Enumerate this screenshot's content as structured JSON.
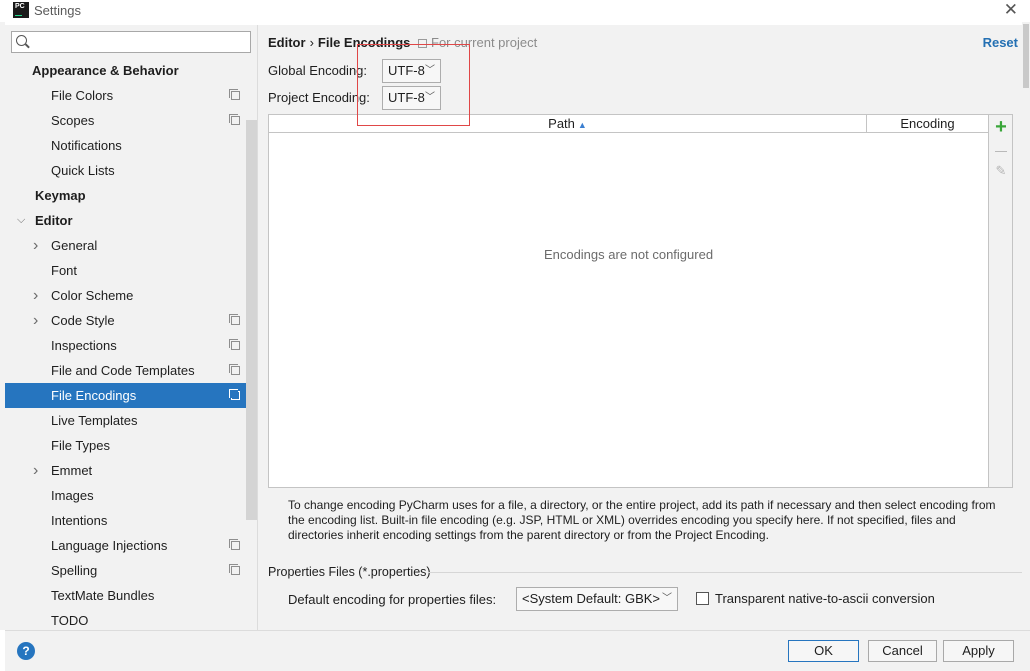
{
  "window": {
    "title": "Settings",
    "app_icon": "pycharm-logo",
    "app_icon_text": "PC"
  },
  "search": {
    "placeholder": "",
    "value": ""
  },
  "sidebar": {
    "items": [
      {
        "label": "Appearance & Behavior",
        "level": 0,
        "bold": true,
        "expanded": true
      },
      {
        "label": "File Colors",
        "level": 1,
        "project_icon": true
      },
      {
        "label": "Scopes",
        "level": 1,
        "project_icon": true
      },
      {
        "label": "Notifications",
        "level": 1
      },
      {
        "label": "Quick Lists",
        "level": 1
      },
      {
        "label": "Keymap",
        "level": 0,
        "bold": true
      },
      {
        "label": "Editor",
        "level": 0,
        "bold": true,
        "expanded": true
      },
      {
        "label": "General",
        "level": 1,
        "collapsed": true
      },
      {
        "label": "Font",
        "level": 1
      },
      {
        "label": "Color Scheme",
        "level": 1,
        "collapsed": true
      },
      {
        "label": "Code Style",
        "level": 1,
        "collapsed": true,
        "project_icon": true
      },
      {
        "label": "Inspections",
        "level": 1,
        "project_icon": true
      },
      {
        "label": "File and Code Templates",
        "level": 1,
        "project_icon": true
      },
      {
        "label": "File Encodings",
        "level": 1,
        "project_icon": true,
        "selected": true
      },
      {
        "label": "Live Templates",
        "level": 1
      },
      {
        "label": "File Types",
        "level": 1
      },
      {
        "label": "Emmet",
        "level": 1,
        "collapsed": true
      },
      {
        "label": "Images",
        "level": 1
      },
      {
        "label": "Intentions",
        "level": 1
      },
      {
        "label": "Language Injections",
        "level": 1,
        "project_icon": true
      },
      {
        "label": "Spelling",
        "level": 1,
        "project_icon": true
      },
      {
        "label": "TextMate Bundles",
        "level": 1
      },
      {
        "label": "TODO",
        "level": 1
      }
    ]
  },
  "header": {
    "breadcrumb_parent": "Editor",
    "breadcrumb_sep": "›",
    "breadcrumb_current": "File Encodings",
    "scope_note": "For current project",
    "reset_label": "Reset"
  },
  "encodings": {
    "global_label": "Global Encoding:",
    "global_value": "UTF-8",
    "project_label": "Project Encoding:",
    "project_value": "UTF-8"
  },
  "table": {
    "col_path": "Path",
    "col_encoding": "Encoding",
    "empty_message": "Encodings are not configured"
  },
  "description": "To change encoding PyCharm uses for a file, a directory, or the entire project, add its path if necessary and then select encoding from the encoding list. Built-in file encoding (e.g. JSP, HTML or XML) overrides encoding you specify here. If not specified, files and directories inherit encoding settings from the parent directory or from the Project Encoding.",
  "properties": {
    "section_title": "Properties Files (*.properties)",
    "default_label": "Default encoding for properties files:",
    "default_value": "<System Default: GBK>",
    "transparent_label": "Transparent native-to-ascii conversion",
    "transparent_checked": false
  },
  "buttons": {
    "help": "?",
    "ok": "OK",
    "cancel": "Cancel",
    "apply": "Apply"
  },
  "colors": {
    "selection": "#2675bf",
    "accent_link": "#2470b3",
    "add_icon": "#3aa63a",
    "annotation_box": "#e04747"
  }
}
